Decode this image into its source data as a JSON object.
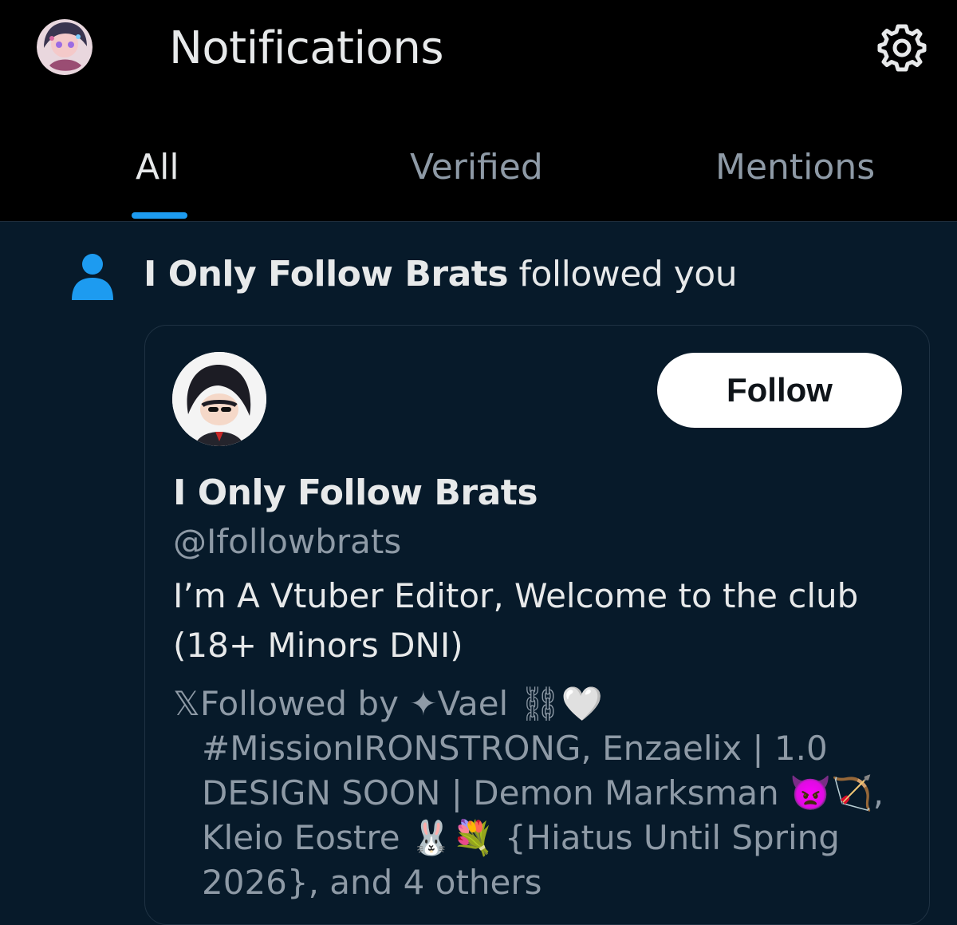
{
  "header": {
    "title": "Notifications",
    "tabs": [
      {
        "label": "All",
        "active": true
      },
      {
        "label": "Verified",
        "active": false
      },
      {
        "label": "Mentions",
        "active": false
      }
    ],
    "icons": {
      "settings": "gear-icon",
      "avatar": "user-avatar"
    }
  },
  "notification": {
    "icon": "person-icon",
    "actor": "I Only Follow Brats",
    "action": " followed you",
    "card": {
      "name": "I Only Follow Brats",
      "handle": "@Ifollowbrats",
      "bio_line1": "I’m A Vtuber Editor, Welcome to the club",
      "bio_line2": "(18+ Minors DNI)",
      "follow_label": "Follow",
      "followed_by": {
        "line1": "𝕏Followed by ✦Vael ⛓🤍",
        "line2": "#MissionIRONSTRONG, Enzaelix | 1.0",
        "line3": "DESIGN SOON | Demon Marksman 👿🏹,",
        "line4": "Kleio Eostre 🐰💐 {Hiatus Until Spring",
        "line5": "2026}, and 4 others"
      }
    }
  },
  "colors": {
    "accent": "#1d9bf0",
    "background_header": "#000000",
    "background_content": "#071a2a",
    "text_primary": "#e7e9ea",
    "text_secondary": "#8e9aa6"
  }
}
